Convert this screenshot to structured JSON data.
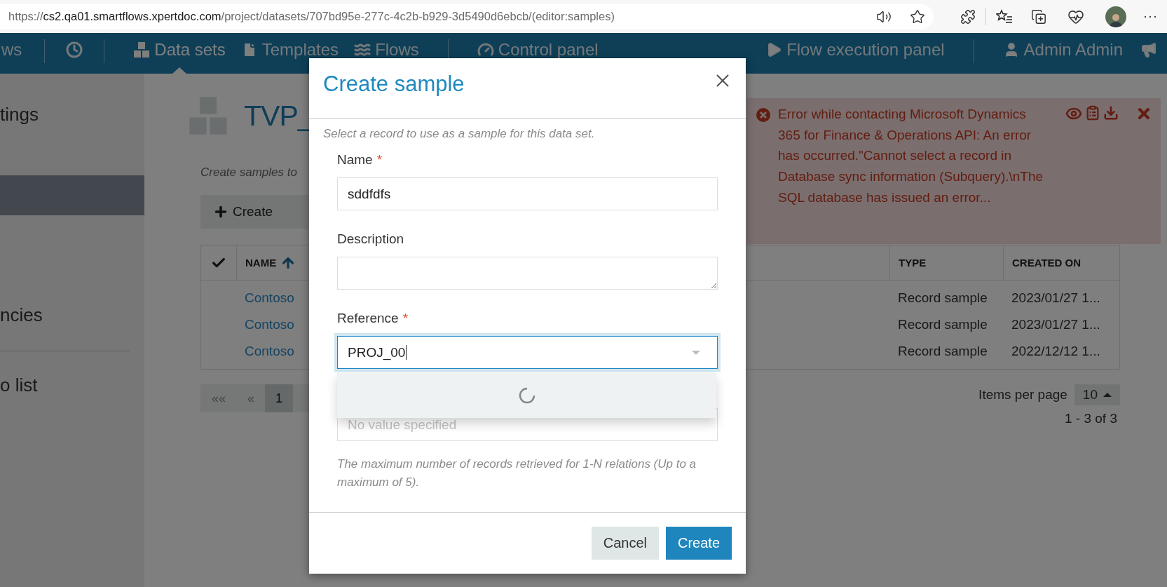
{
  "browser": {
    "url_scheme": "https://",
    "url_host": "cs2.qa01.smartflows.xpertdoc.com",
    "url_path": "/project/datasets/707bd95e-277c-4c2b-b929-3d5490d6ebcb/(editor:samples)",
    "more": "···"
  },
  "nav": {
    "items": [
      {
        "kind": "link",
        "label": "ws",
        "selected": false
      },
      {
        "kind": "divider"
      },
      {
        "kind": "icon"
      },
      {
        "kind": "divider"
      },
      {
        "kind": "link",
        "label": "Data sets",
        "selected": true
      },
      {
        "kind": "link",
        "label": "Templates",
        "selected": false
      },
      {
        "kind": "link",
        "label": "Flows",
        "selected": false
      },
      {
        "kind": "divider"
      },
      {
        "kind": "link",
        "label": "Control panel",
        "selected": false
      },
      {
        "kind": "spacer"
      },
      {
        "kind": "link",
        "label": "Flow execution panel",
        "selected": false
      },
      {
        "kind": "divider"
      },
      {
        "kind": "link",
        "label": "Admin Admin",
        "selected": false
      },
      {
        "kind": "icon"
      }
    ]
  },
  "sidebar": {
    "items": [
      {
        "kind": "item",
        "label": "tings",
        "selected": false
      },
      {
        "kind": "item",
        "selected": true
      },
      {
        "kind": "item",
        "label": "ncies",
        "selected": false
      },
      {
        "kind": "divider"
      },
      {
        "kind": "item",
        "label": "o list",
        "selected": false
      }
    ]
  },
  "main": {
    "title": "TVP_",
    "subtitle": "Create samples to",
    "toolbar": {
      "create": "Create"
    },
    "table": {
      "columns": [
        {
          "kind": "check"
        },
        {
          "kind": "sort",
          "label": "NAME"
        },
        {
          "kind": "text",
          "label": "TYPE"
        },
        {
          "kind": "text",
          "label": "CREATED ON"
        }
      ],
      "rows": [
        {
          "name": "Contoso",
          "type": "Record sample",
          "created_on": "2023/01/27 1..."
        },
        {
          "name": "Contoso",
          "type": "Record sample",
          "created_on": "2023/01/27 1..."
        },
        {
          "name": "Contoso",
          "type": "Record sample",
          "created_on": "2022/12/12 1..."
        }
      ]
    },
    "pagination": {
      "first": "««",
      "prev": "«",
      "pages": [
        {
          "label": "1",
          "selected": true
        }
      ],
      "items_per_page_label": "Items per page",
      "items_per_page": "10",
      "range": "1 - 3 of 3"
    }
  },
  "toast": {
    "message": "Error while contacting Microsoft Dynamics 365 for Finance & Operations API: An error has occurred.\"Cannot select a record in Database sync information (Subquery).\\nThe SQL database has issued an error..."
  },
  "dialog": {
    "title": "Create sample",
    "intro": "Select a record to use as a sample for this data set.",
    "fields": [
      {
        "kind": "input",
        "label": "Name",
        "required_mark": "*",
        "value": "sddfdfs"
      },
      {
        "kind": "textarea",
        "label": "Description"
      },
      {
        "kind": "combo",
        "label": "Reference",
        "required_mark": "*",
        "value": "PROJ_00",
        "focused": true
      },
      {
        "kind": "covered",
        "placeholder": "No value specified"
      }
    ],
    "dropdown": {
      "loading": true
    },
    "help": "The maximum number of records retrieved for 1-N relations (Up to a maximum of 5).",
    "buttons": [
      {
        "kind": "secondary",
        "label": "Cancel"
      },
      {
        "kind": "primary",
        "label": "Create"
      }
    ]
  }
}
